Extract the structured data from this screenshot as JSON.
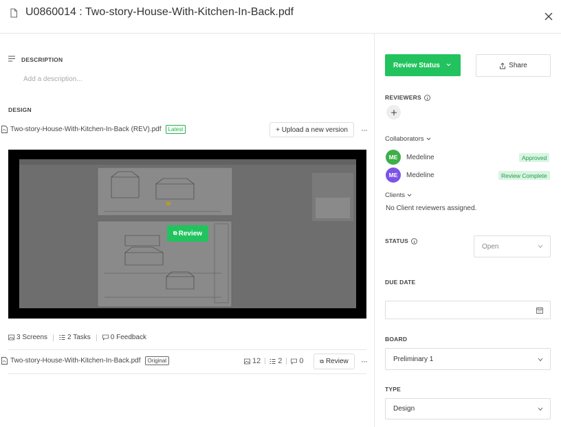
{
  "header": {
    "title": "U0860014 : Two-story-House-With-Kitchen-In-Back.pdf",
    "file_icon": "file-icon",
    "close_icon": "close-icon"
  },
  "description": {
    "label": "DESCRIPTION",
    "placeholder": "Add a description..."
  },
  "design": {
    "label": "DESIGN",
    "latest": {
      "file_name": "Two-story-House-With-Kitchen-In-Back (REV).pdf",
      "badge": "Latest",
      "upload_label": "+ Upload a new version",
      "review_overlay_label": "Review"
    },
    "stats": {
      "screens": "3 Screens",
      "tasks": "2 Tasks",
      "feedback": "0 Feedback"
    },
    "original": {
      "file_name": "Two-story-House-With-Kitchen-In-Back.pdf",
      "badge": "Original",
      "screens_count": "12",
      "tasks_count": "2",
      "feedback_count": "0",
      "review_label": "Review"
    }
  },
  "sidebar": {
    "review_status_label": "Review Status",
    "share_label": "Share",
    "reviewers_label": "REVIEWERS",
    "collaborators_label": "Collaborators",
    "collaborators": [
      {
        "initials": "ME",
        "name": "Medeline",
        "status": "Approved",
        "avatar_color": "#3fae49"
      },
      {
        "initials": "ME",
        "name": "Medeline",
        "status": "Review Complete",
        "avatar_color": "#7c53e6"
      }
    ],
    "clients_label": "Clients",
    "clients_empty": "No Client reviewers assigned.",
    "status_label": "STATUS",
    "status_value": "Open",
    "due_date_label": "DUE DATE",
    "board_label": "BOARD",
    "board_value": "Preliminary 1",
    "type_label": "TYPE",
    "type_value": "Design"
  },
  "colors": {
    "accent_green": "#22c35e",
    "badge_green_bg": "#d9f5e2",
    "badge_green_text": "#1f9a4b"
  }
}
